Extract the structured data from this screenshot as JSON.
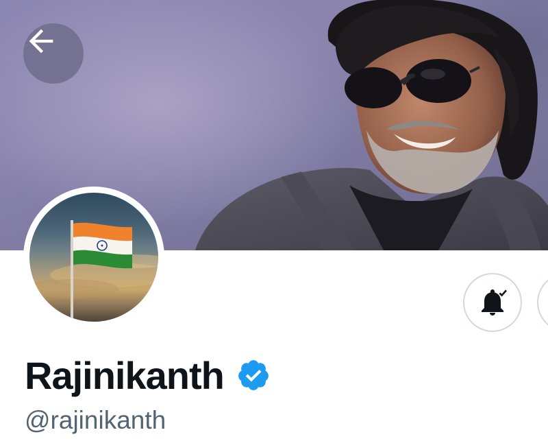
{
  "profile": {
    "display_name": "Rajinikanth",
    "handle": "@rajinikanth",
    "verified": true
  },
  "icons": {
    "back": "arrow-left-icon",
    "notifications": "bell-check-icon",
    "verified": "verified-badge-icon",
    "avatar_flag": "india-flag"
  },
  "colors": {
    "name_text": "#0f1419",
    "handle_text": "#536471",
    "verified_blue": "#1d9bf0",
    "button_border": "#cfd9de",
    "banner_bg": "#8d87b3"
  }
}
